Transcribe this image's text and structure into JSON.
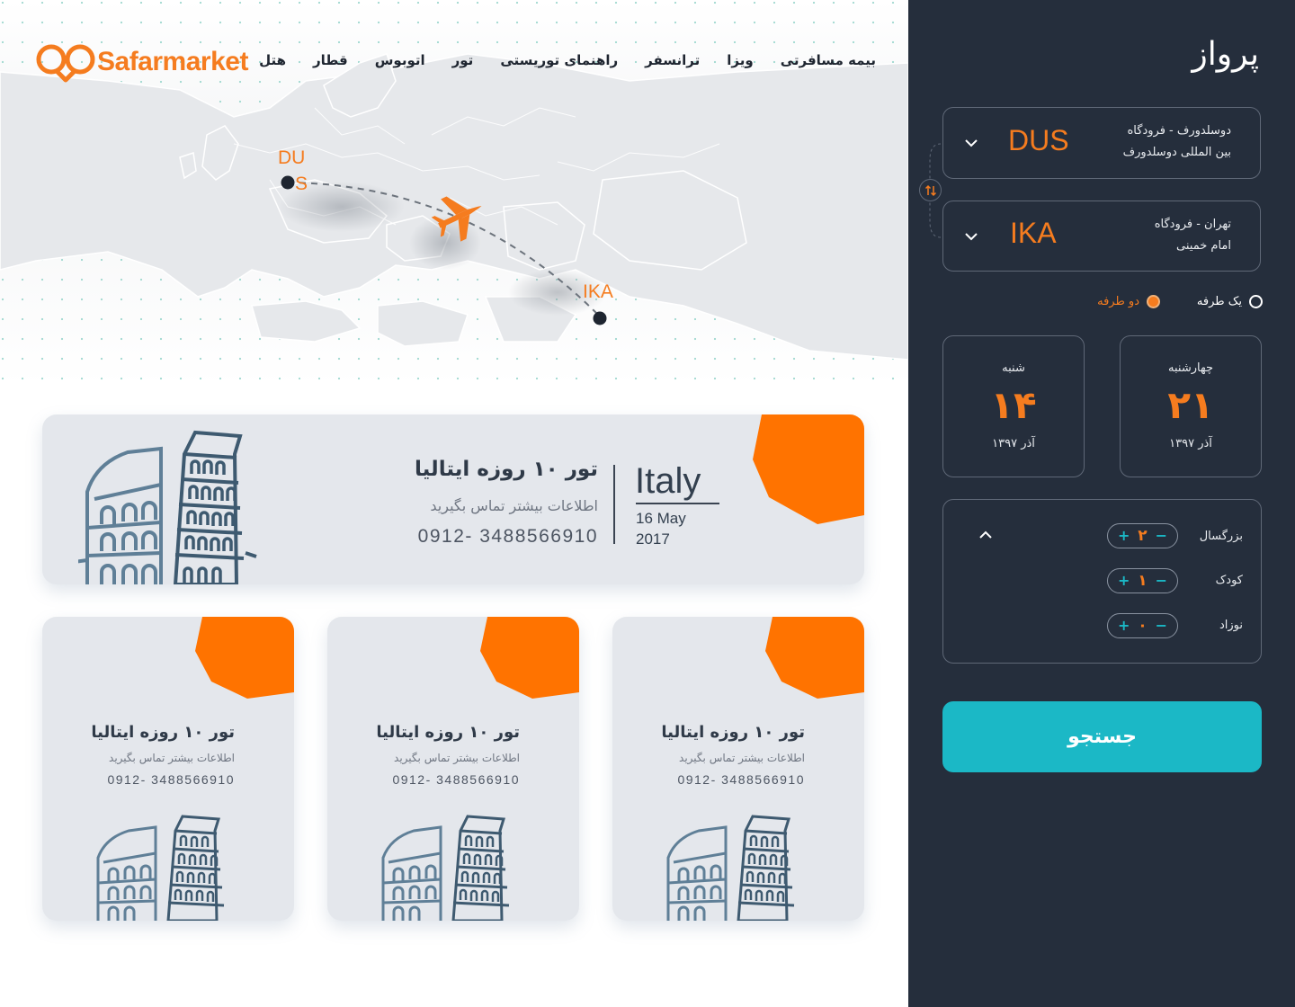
{
  "brand": {
    "name": "Safarmarket",
    "color": "#f57c1f"
  },
  "nav": {
    "items": [
      {
        "label": "هتل"
      },
      {
        "label": "قطار"
      },
      {
        "label": "اتوبوس"
      },
      {
        "label": "تور"
      },
      {
        "label": "راهنمای توریستی"
      },
      {
        "label": "ترانسفر"
      },
      {
        "label": "ویزا"
      },
      {
        "label": "بیمه مسافرتی"
      }
    ]
  },
  "map": {
    "origin_line1": "DU",
    "origin_line2": "S",
    "destination_label": "IKA",
    "icon": "airplane-icon"
  },
  "featured_card": {
    "title": "تور ۱۰ روزه ایتالیا",
    "subtitle": "اطلاعات بیشتر تماس بگیرید",
    "phone": "0912- 3488566910",
    "country": "Italy",
    "date_line1": "16 May",
    "date_line2": "2017"
  },
  "cards": [
    {
      "title": "تور ۱۰ روزه ایتالیا",
      "subtitle": "اطلاعات بیشتر تماس بگیرید",
      "phone": "0912- 3488566910"
    },
    {
      "title": "تور ۱۰ روزه ایتالیا",
      "subtitle": "اطلاعات بیشتر تماس بگیرید",
      "phone": "0912- 3488566910"
    },
    {
      "title": "تور ۱۰ روزه ایتالیا",
      "subtitle": "اطلاعات بیشتر تماس بگیرید",
      "phone": "0912- 3488566910"
    }
  ],
  "panel": {
    "title": "پرواز",
    "origin": {
      "line1": "دوسلدورف - فرودگاه",
      "line2": "بین المللی دوسلدورف",
      "code": "DUS"
    },
    "destination": {
      "line1": "تهران - فرودگاه",
      "line2": "امام خمینی",
      "code": "IKA"
    },
    "trip_type": {
      "one_way": "یک طرفه",
      "round_trip": "دو طرفه",
      "selected": "round_trip"
    },
    "depart": {
      "weekday": "چهارشنبه",
      "day": "۲۱",
      "month": "آذر ۱۳۹۷"
    },
    "return": {
      "weekday": "شنبه",
      "day": "۱۴",
      "month": "آذر ۱۳۹۷"
    },
    "passengers": [
      {
        "label": "بزرگسال",
        "value": "۲"
      },
      {
        "label": "کودک",
        "value": "۱"
      },
      {
        "label": "نوزاد",
        "value": "۰"
      }
    ],
    "stepper_plus": "+",
    "stepper_minus": "−",
    "search_label": "جستجو"
  },
  "colors": {
    "accent": "#f57c1f",
    "panel_bg": "#252e3c",
    "search_bg": "#1bb8c6",
    "card_bg": "#e4e7ec"
  }
}
